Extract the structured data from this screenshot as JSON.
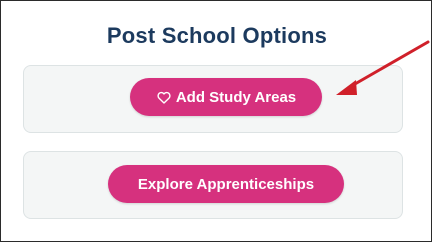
{
  "section": {
    "title": "Post School Options"
  },
  "buttons": {
    "add_study_areas": {
      "label": "Add Study Areas",
      "icon": "heart-outline-icon"
    },
    "explore_apprenticeships": {
      "label": "Explore Apprenticeships"
    }
  },
  "annotation": {
    "arrow_color": "#d0202a"
  },
  "colors": {
    "title": "#1c3a5e",
    "button": "#d6317e",
    "card_background": "#f4f6f6"
  }
}
